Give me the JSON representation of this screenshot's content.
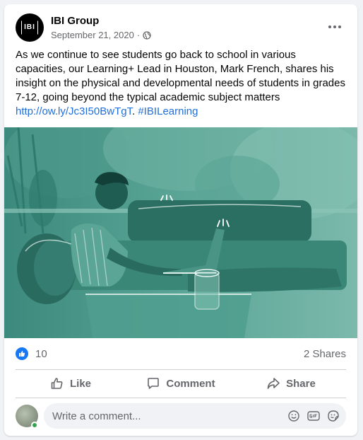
{
  "post": {
    "page_name": "IBI Group",
    "avatar_text": "IBI",
    "date": "September 21, 2020",
    "separator": "·",
    "privacy_icon": "globe-icon",
    "text_main": "As we continue to see students go back to school in various capacities, our Learning+ Lead in Houston, Mark French, shares his insight on the physical and developmental needs of students in grades 7-12, going beyond the typical academic subject matters ",
    "link_text": "http://ow.ly/Jc3I50BwTgT",
    "text_after_link": ". ",
    "hashtag": "#IBILearning"
  },
  "counts": {
    "likes": "10",
    "shares": "2 Shares"
  },
  "actions": {
    "like": "Like",
    "comment": "Comment",
    "share": "Share"
  },
  "comment_box": {
    "placeholder": "Write a comment..."
  },
  "colors": {
    "accent": "#1877f2",
    "link": "#216fdb",
    "media_tint": "#3f8f82",
    "online": "#31a24c"
  }
}
